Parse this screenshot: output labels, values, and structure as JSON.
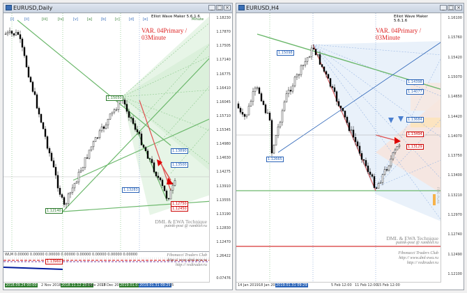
{
  "left": {
    "title": "EURUSD,Daily",
    "header": "Elliot Wave Maker 5.6.1.6",
    "variant": "VAR. 04Primary / 03Minute",
    "minute_label": "Minute",
    "price_ticks": [
      "1.18230",
      "1.17870",
      "1.17505",
      "1.17140",
      "1.16775",
      "1.16410",
      "1.16045",
      "1.15710",
      "1.15345",
      "1.14980",
      "1.14630",
      "1.14275",
      "1.13910",
      "1.13555",
      "1.13190",
      "1.12830",
      "1.12470"
    ],
    "wave_labels_top": [
      "[i]",
      "[ii]",
      "[iii]",
      "[iv]",
      "[v]",
      "[a]",
      "[b]",
      "[c]",
      "[d]",
      "[e]"
    ],
    "tags": [
      {
        "text": "1.15050",
        "cls": "green"
      },
      {
        "text": "1.13890",
        "cls": ""
      },
      {
        "text": "1.13500",
        "cls": ""
      },
      {
        "text": "1.12750",
        "cls": "red"
      },
      {
        "text": "1.12450",
        "cls": "red"
      },
      {
        "text": "1.12140",
        "cls": "green"
      },
      {
        "text": "1.13283",
        "cls": ""
      }
    ],
    "sub_title": "WLM 0.00000 0.00000 0.00000 0.00000 0.00000 0.00000 0.00000 0.00000",
    "sub_ticks": [
      "1.26422",
      "0.07476"
    ],
    "sub_tag": "1.13960",
    "time_labels": [
      "2018.09.24 00:00",
      "2 Nov 2018",
      "2018.11.12 23:00",
      "3 Nov 2018",
      "17 Dec 2018",
      "2019.01.07",
      "2019.01.31 09:29",
      "15"
    ],
    "promo_title": "DML & EWA Technique",
    "promo_email": "putnik-post @ rambler.ru",
    "promo_club": "Fibonacci    Traders    Club",
    "promo_url1": "http:// www.dml-ewa.ru",
    "promo_url2": "http:// redtrader.ru"
  },
  "right": {
    "title": "EURUSD,H4",
    "header": "Elliot Wave Maker 5.6.1.6",
    "variant": "VAR. 04Primary / 03Minute",
    "price_ticks": [
      "1.16100",
      "1.15760",
      "1.15420",
      "1.15070",
      "1.14650",
      "1.14420",
      "1.14070",
      "1.13750",
      "1.13400",
      "1.13210",
      "1.12970",
      "1.12740",
      "1.12490",
      "1.12100"
    ],
    "tags": [
      {
        "text": "1.15098",
        "cls": ""
      },
      {
        "text": "1.14398",
        "cls": ""
      },
      {
        "text": "1.14077",
        "cls": ""
      },
      {
        "text": "1.13684",
        "cls": ""
      },
      {
        "text": "1.13494",
        "cls": "red"
      },
      {
        "text": "1.13129",
        "cls": "red"
      },
      {
        "text": "1.12665",
        "cls": ""
      }
    ],
    "time_labels": [
      "14 Jan 2019",
      "18 Jan 2019",
      "2019.01.31 09:29",
      "5 Feb 12:00",
      "11 Feb 12:00",
      "15 Feb 12:00"
    ],
    "promo_title": "DML & EWA Technique",
    "promo_email": "putnik-post @ rambler.ru",
    "promo_club": "Fibonacci    Traders    Club",
    "promo_url1": "http:// www.dml-ewa.ru",
    "promo_url2": "http:// redtrader.ru",
    "side_label": "FIBO PLAN"
  },
  "colors": {
    "bull": "#2c7a2c",
    "bear": "#c00000",
    "blue": "#2a63b7",
    "fan_green": "#9fd49f",
    "fan_blue": "#cfe0f6"
  },
  "window_buttons": {
    "min": "_",
    "max": "□",
    "close": "×"
  }
}
